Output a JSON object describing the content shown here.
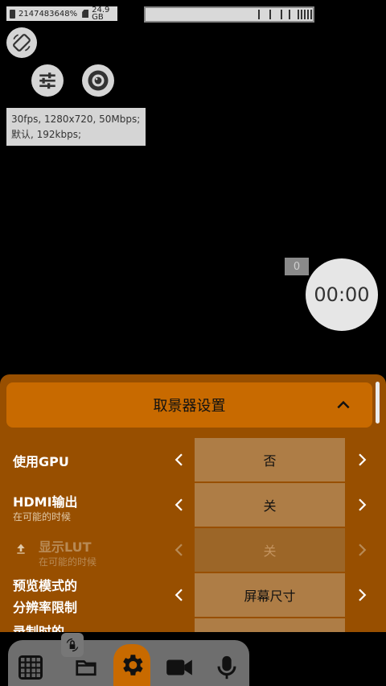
{
  "status": {
    "free_space": "2147483648%",
    "storage_top": "24.9",
    "storage_unit": "GB"
  },
  "info": {
    "line1": "30fps, 1280x720, 50Mbps;",
    "line2": "默认, 192kbps;"
  },
  "record": {
    "counter": "0",
    "timer": "00:00"
  },
  "panel": {
    "title": "取景器设置",
    "rows": [
      {
        "label": "使用GPU",
        "sub": "",
        "value": "否",
        "enabled": true
      },
      {
        "label": "HDMI输出",
        "sub": "在可能的时候",
        "value": "关",
        "enabled": true
      },
      {
        "label": "显示LUT",
        "sub": "在可能的时候",
        "value": "关",
        "enabled": false
      },
      {
        "label_line1": "预览模式的",
        "label_line2": "分辨率限制",
        "value": "屏幕尺寸",
        "enabled": true
      },
      {
        "label": "录制时的",
        "value": ""
      }
    ]
  },
  "icons": {
    "rotate": "screen-rotation-icon",
    "settings_sliders": "tune-sliders-icon",
    "lens": "camera-lens-icon",
    "grid": "grid-icon",
    "folder": "folder-icon",
    "gear": "gear-icon",
    "video": "video-camera-icon",
    "mic": "microphone-icon",
    "lock": "lock-rotate-icon"
  },
  "colors": {
    "panel": "#984f00",
    "header": "#c86a00",
    "value_cell": "#ae7d46",
    "active_tab": "#c86a00"
  }
}
